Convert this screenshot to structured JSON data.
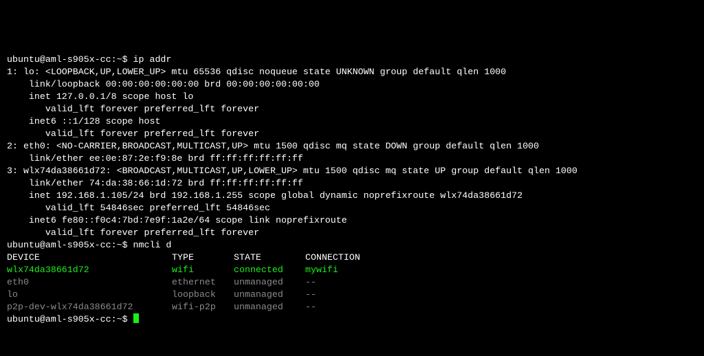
{
  "prompt1": {
    "user_host": "ubuntu@aml-s905x-cc",
    "path": ":~$ ",
    "cmd": "ip addr"
  },
  "ipaddr": {
    "l01": "1: lo: <LOOPBACK,UP,LOWER_UP> mtu 65536 qdisc noqueue state UNKNOWN group default qlen 1000",
    "l02": "    link/loopback 00:00:00:00:00:00 brd 00:00:00:00:00:00",
    "l03": "    inet 127.0.0.1/8 scope host lo",
    "l04": "       valid_lft forever preferred_lft forever",
    "l05": "    inet6 ::1/128 scope host",
    "l06": "       valid_lft forever preferred_lft forever",
    "l07": "2: eth0: <NO-CARRIER,BROADCAST,MULTICAST,UP> mtu 1500 qdisc mq state DOWN group default qlen 1000",
    "l08": "    link/ether ee:0e:87:2e:f9:8e brd ff:ff:ff:ff:ff:ff",
    "l09": "3: wlx74da38661d72: <BROADCAST,MULTICAST,UP,LOWER_UP> mtu 1500 qdisc mq state UP group default qlen 1000",
    "l10": "    link/ether 74:da:38:66:1d:72 brd ff:ff:ff:ff:ff:ff",
    "l11": "    inet 192.168.1.105/24 brd 192.168.1.255 scope global dynamic noprefixroute wlx74da38661d72",
    "l12": "       valid_lft 54846sec preferred_lft 54846sec",
    "l13": "    inet6 fe80::f0c4:7bd:7e9f:1a2e/64 scope link noprefixroute",
    "l14": "       valid_lft forever preferred_lft forever"
  },
  "prompt2": {
    "user_host": "ubuntu@aml-s905x-cc",
    "path": ":~$ ",
    "cmd": "nmcli d"
  },
  "nmcli": {
    "hdr": {
      "dev": "DEVICE",
      "type": "TYPE",
      "state": "STATE",
      "conn": "CONNECTION"
    },
    "rows": [
      {
        "dev": "wlx74da38661d72",
        "type": "wifi",
        "state": "connected",
        "conn": "mywifi",
        "active": true
      },
      {
        "dev": "eth0",
        "type": "ethernet",
        "state": "unmanaged",
        "conn": "--",
        "active": false
      },
      {
        "dev": "lo",
        "type": "loopback",
        "state": "unmanaged",
        "conn": "--",
        "active": false
      },
      {
        "dev": "p2p-dev-wlx74da38661d72",
        "type": "wifi-p2p",
        "state": "unmanaged",
        "conn": "--",
        "active": false
      }
    ]
  },
  "prompt3": {
    "user_host": "ubuntu@aml-s905x-cc",
    "path": ":~$ "
  }
}
